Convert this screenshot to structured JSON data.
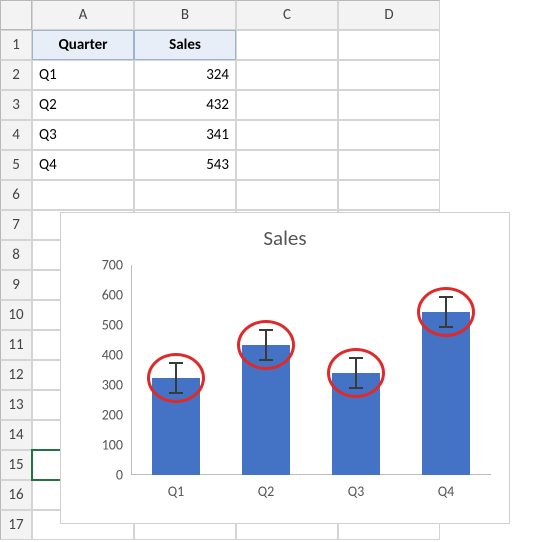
{
  "columns": [
    "A",
    "B",
    "C",
    "D"
  ],
  "rows": [
    "1",
    "2",
    "3",
    "4",
    "5",
    "6",
    "7",
    "8",
    "9",
    "10",
    "11",
    "12",
    "13",
    "14",
    "15",
    "16",
    "17"
  ],
  "selected_row": 15,
  "table": {
    "headers": {
      "quarter": "Quarter",
      "sales": "Sales"
    },
    "data": [
      {
        "quarter": "Q1",
        "sales": "324"
      },
      {
        "quarter": "Q2",
        "sales": "432"
      },
      {
        "quarter": "Q3",
        "sales": "341"
      },
      {
        "quarter": "Q4",
        "sales": "543"
      }
    ]
  },
  "chart": {
    "title": "Sales"
  },
  "chart_data": {
    "type": "bar",
    "title": "Sales",
    "categories": [
      "Q1",
      "Q2",
      "Q3",
      "Q4"
    ],
    "values": [
      324,
      432,
      341,
      543
    ],
    "error_bars": {
      "amount": 50,
      "shown": true
    },
    "annotations": "red ellipse callouts surrounding each error bar",
    "ylim": [
      0,
      700
    ],
    "ytick_step": 100,
    "y_ticks": [
      0,
      100,
      200,
      300,
      400,
      500,
      600,
      700
    ],
    "xlabel": "",
    "ylabel": ""
  }
}
